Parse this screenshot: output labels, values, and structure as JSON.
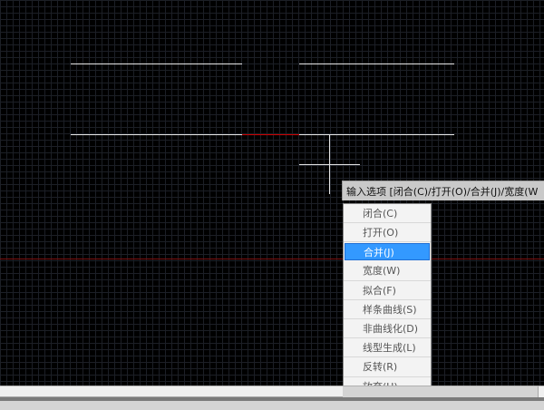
{
  "command_prompt": {
    "text": "输入选项 [闭合(C)/打开(O)/合并(J)/宽度(W"
  },
  "options_menu": {
    "items": [
      {
        "label": "闭合(C)"
      },
      {
        "label": "打开(O)"
      },
      {
        "label": "合并(J)"
      },
      {
        "label": "宽度(W)"
      },
      {
        "label": "拟合(F)"
      },
      {
        "label": "样条曲线(S)"
      },
      {
        "label": "非曲线化(D)"
      },
      {
        "label": "线型生成(L)"
      },
      {
        "label": "反转(R)"
      },
      {
        "label": "放弃(U)"
      }
    ],
    "selected_index": 2
  },
  "colors": {
    "canvas_background": "#000000",
    "line": "#e6e6e6",
    "highlight_segment": "#cc0000",
    "axis_line": "#7a1010",
    "menu_selected": "#3399ff"
  }
}
